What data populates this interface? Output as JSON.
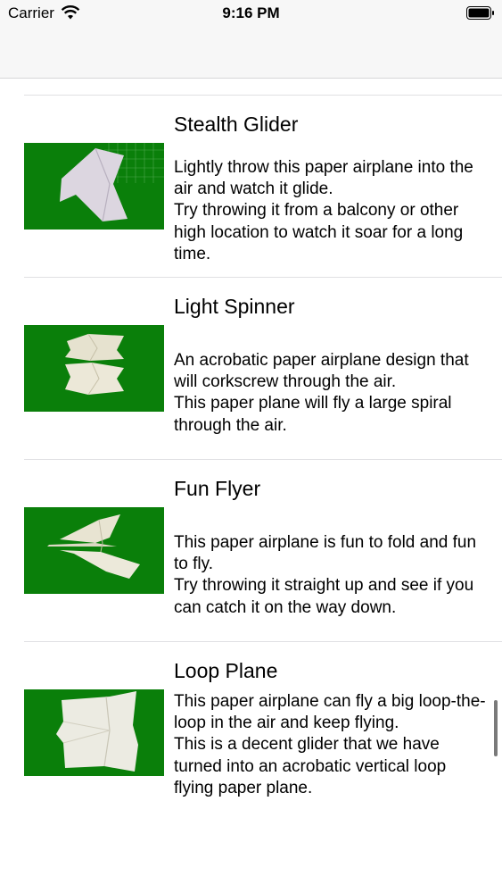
{
  "status": {
    "carrier": "Carrier",
    "time": "9:16 PM"
  },
  "items": [
    {
      "title": "Stealth Glider",
      "description": "Lightly throw this paper airplane into the air and watch it glide.\nTry throwing it from a balcony or other high location to watch it soar for a long time."
    },
    {
      "title": "Light Spinner",
      "description": "An acrobatic paper airplane design that will corkscrew through the air.\nThis paper plane will fly a large spiral through the air."
    },
    {
      "title": "Fun Flyer",
      "description": "This paper airplane is fun to fold and fun to fly.\nTry throwing it straight up and see if you can catch it on the way down."
    },
    {
      "title": "Loop Plane",
      "description": "This paper airplane can fly a big loop-the-loop in the air and keep flying.\nThis is a decent glider that we have turned into an acrobatic vertical loop flying paper plane."
    }
  ],
  "colors": {
    "thumb_background": "#0a7f0a",
    "bar_background": "#f7f7f7"
  }
}
